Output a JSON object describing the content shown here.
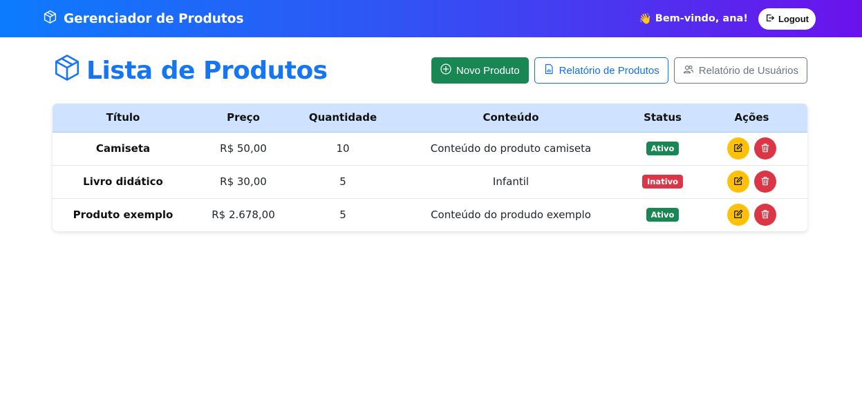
{
  "navbar": {
    "brand": "Gerenciador de Produtos",
    "brand_icon": "box-icon",
    "welcome_emoji": "👋",
    "welcome": "Bem-vindo, ana!",
    "logout": "Logout",
    "gradient_start": "#0d7bfd",
    "gradient_end": "#6b12ec"
  },
  "page": {
    "title": "Lista de Produtos",
    "title_color": "#1675f2",
    "buttons": {
      "new_product": "Novo Produto",
      "product_report": "Relatório de Produtos",
      "user_report": "Relatório de Usuários"
    }
  },
  "table": {
    "headers": {
      "title": "Título",
      "price": "Preço",
      "quantity": "Quantidade",
      "content": "Conteúdo",
      "status": "Status",
      "actions": "Ações"
    },
    "rows": [
      {
        "title": "Camiseta",
        "price": "R$ 50,00",
        "quantity": "10",
        "content": "Conteúdo do produto camiseta",
        "status": "Ativo"
      },
      {
        "title": "Livro didático",
        "price": "R$ 30,00",
        "quantity": "5",
        "content": "Infantil",
        "status": "Inativo"
      },
      {
        "title": "Produto exemplo",
        "price": "R$ 2.678,00",
        "quantity": "5",
        "content": "Conteúdo do produdo exemplo",
        "status": "Ativo"
      }
    ]
  },
  "colors": {
    "success": "#198754",
    "danger": "#dc3545",
    "warning": "#ffc107",
    "primary": "#0d6efd",
    "secondary": "#6c757d",
    "table_header": "#cfe2ff"
  }
}
